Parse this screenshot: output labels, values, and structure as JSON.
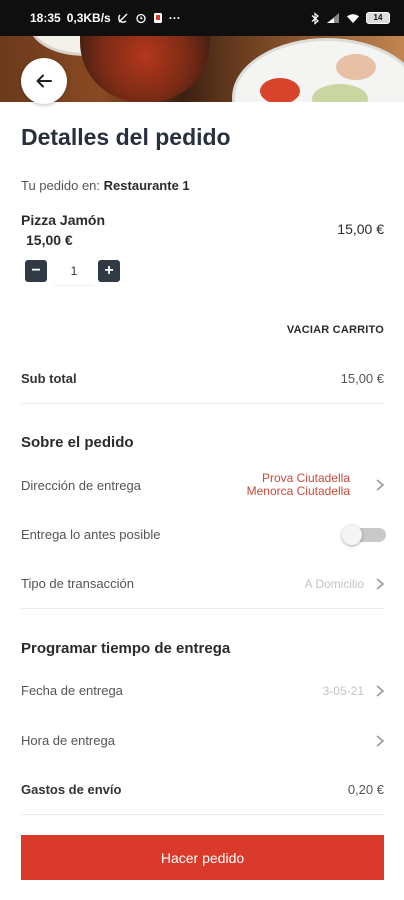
{
  "status_bar": {
    "time": "18:35",
    "network_speed": "0,3KB/s",
    "battery": "14",
    "more": "···"
  },
  "header": {
    "back_icon": "arrow-left-icon"
  },
  "order": {
    "title": "Detalles del pedido",
    "restaurant_prefix": "Tu pedido en:",
    "restaurant_name": "Restaurante 1",
    "item": {
      "name": "Pizza Jamón",
      "unit_price": "15,00 €",
      "total_price": "15,00 €",
      "quantity": "1",
      "minus": "−",
      "plus": "+"
    },
    "empty_cart_label": "VACIAR CARRITO",
    "subtotal_label": "Sub total",
    "subtotal_value": "15,00 €"
  },
  "about": {
    "title": "Sobre el pedido",
    "address_label": "Dirección de entrega",
    "address_line1": "Prova Ciutadella",
    "address_line2": "Menorca Ciutadella",
    "asap_label": "Entrega lo antes posible",
    "asap_enabled": false,
    "transaction_label": "Tipo de transacción",
    "transaction_value": "A Domicilio"
  },
  "schedule": {
    "title": "Programar tiempo de entrega",
    "date_label": "Fecha de entrega",
    "date_value": "3-05-21",
    "time_label": "Hora de entrega",
    "shipping_label": "Gastos de envío",
    "shipping_value": "0,20 €"
  },
  "footer": {
    "order_button": "Hacer pedido"
  },
  "colors": {
    "accent": "#d93a2b",
    "address_red": "#c84a3a",
    "title": "#283040",
    "stepper": "#2f3a45"
  }
}
